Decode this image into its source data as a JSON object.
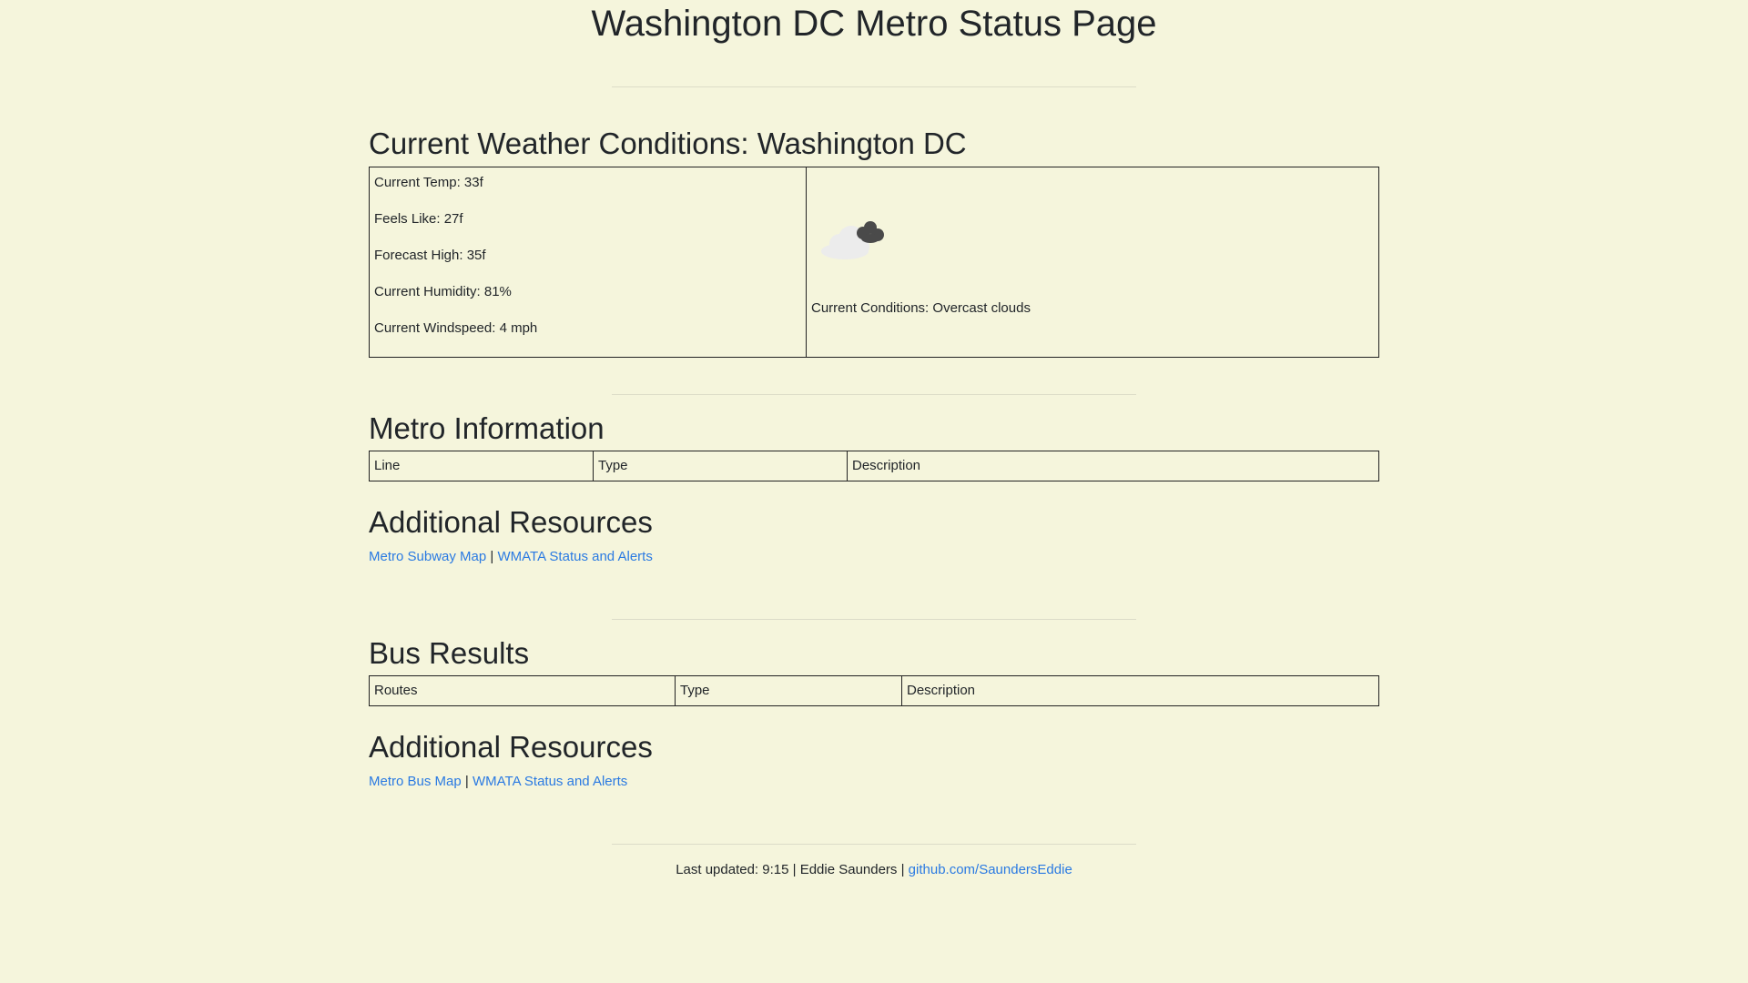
{
  "page_title": "Washington DC Metro Status Page",
  "weather": {
    "heading": "Current Weather Conditions: Washington DC",
    "temp": "Current Temp: 33f",
    "feels_like": "Feels Like: 27f",
    "forecast_high": "Forecast High: 35f",
    "humidity": "Current Humidity: 81%",
    "windspeed": "Current Windspeed: 4 mph",
    "icon": "overcast-clouds-icon",
    "conditions": "Current Conditions: Overcast clouds"
  },
  "metro": {
    "heading": "Metro Information",
    "columns": [
      "Line",
      "Type",
      "Description"
    ],
    "resources_heading": "Additional Resources",
    "links": [
      "Metro Subway Map",
      "WMATA Status and Alerts"
    ],
    "separator": "|"
  },
  "bus": {
    "heading": "Bus Results",
    "columns": [
      "Routes",
      "Type",
      "Description"
    ],
    "resources_heading": "Additional Resources",
    "links": [
      "Metro Bus Map",
      "WMATA Status and Alerts"
    ],
    "separator": "|"
  },
  "footer": {
    "text": "Last updated: 9:15 | Eddie Saunders | ",
    "link": "github.com/SaundersEddie"
  },
  "colors": {
    "background": "#f5f5dc",
    "link": "#2a7ae2",
    "text": "#212529"
  }
}
